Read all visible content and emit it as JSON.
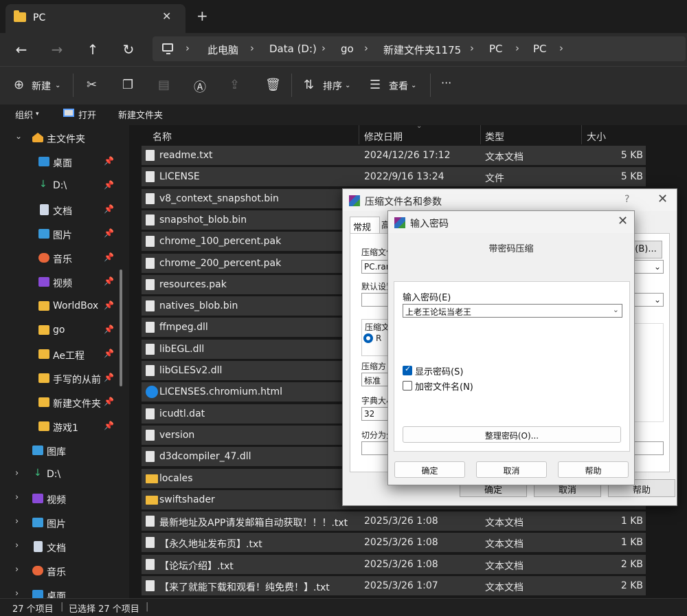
{
  "tab": {
    "title": "PC"
  },
  "nav": {
    "back": "←",
    "forward": "→",
    "up": "↑",
    "refresh": "↻",
    "breadcrumb": [
      "此电脑",
      "Data (D:)",
      "go",
      "新建文件夹1175",
      "PC",
      "PC"
    ]
  },
  "toolbar": {
    "new_label": "新建",
    "sort_label": "排序",
    "view_label": "查看",
    "more_label": "···"
  },
  "subbar": {
    "organize": "组织",
    "open": "打开",
    "new_folder": "新建文件夹"
  },
  "sidebar": {
    "home": "主文件夹",
    "pinned": [
      "桌面",
      "D:\\",
      "文档",
      "图片",
      "音乐",
      "视频",
      "WorldBox",
      "go",
      "Ae工程",
      "手写的从前",
      "新建文件夹",
      "游戏1"
    ],
    "gallery": "图库",
    "tree": [
      "D:\\",
      "视频",
      "图片",
      "文档",
      "音乐",
      "桌面"
    ]
  },
  "columns": {
    "name": "名称",
    "date": "修改日期",
    "type": "类型",
    "size": "大小"
  },
  "files": [
    {
      "name": "readme.txt",
      "date": "2024/12/26 17:12",
      "type": "文本文档",
      "size": "5 KB",
      "icon": "doc"
    },
    {
      "name": "LICENSE",
      "date": "2022/9/16 13:24",
      "type": "文件",
      "size": "5 KB",
      "icon": "file"
    },
    {
      "name": "v8_context_snapshot.bin",
      "date": "",
      "type": "",
      "size": "",
      "icon": "file"
    },
    {
      "name": "snapshot_blob.bin",
      "date": "",
      "type": "",
      "size": "",
      "icon": "file"
    },
    {
      "name": "chrome_100_percent.pak",
      "date": "",
      "type": "",
      "size": "",
      "icon": "file"
    },
    {
      "name": "chrome_200_percent.pak",
      "date": "",
      "type": "",
      "size": "",
      "icon": "file"
    },
    {
      "name": "resources.pak",
      "date": "",
      "type": "",
      "size": "",
      "icon": "file"
    },
    {
      "name": "natives_blob.bin",
      "date": "",
      "type": "",
      "size": "",
      "icon": "file"
    },
    {
      "name": "ffmpeg.dll",
      "date": "",
      "type": "",
      "size": "",
      "icon": "dll"
    },
    {
      "name": "libEGL.dll",
      "date": "",
      "type": "",
      "size": "",
      "icon": "dll"
    },
    {
      "name": "libGLESv2.dll",
      "date": "",
      "type": "",
      "size": "",
      "icon": "dll"
    },
    {
      "name": "LICENSES.chromium.html",
      "date": "",
      "type": "",
      "size": "",
      "icon": "edge"
    },
    {
      "name": "icudtl.dat",
      "date": "",
      "type": "",
      "size": "",
      "icon": "file"
    },
    {
      "name": "version",
      "date": "",
      "type": "",
      "size": "",
      "icon": "file"
    },
    {
      "name": "d3dcompiler_47.dll",
      "date": "",
      "type": "",
      "size": "",
      "icon": "dll"
    },
    {
      "name": "locales",
      "date": "",
      "type": "",
      "size": "",
      "icon": "folder"
    },
    {
      "name": "swiftshader",
      "date": "",
      "type": "",
      "size": "",
      "icon": "folder"
    },
    {
      "name": "最新地址及APP请发邮箱自动获取！！！.txt",
      "date": "2025/3/26 1:08",
      "type": "文本文档",
      "size": "1 KB",
      "icon": "doc"
    },
    {
      "name": "【永久地址发布页】.txt",
      "date": "2025/3/26 1:08",
      "type": "文本文档",
      "size": "1 KB",
      "icon": "doc"
    },
    {
      "name": "【论坛介绍】.txt",
      "date": "2025/3/26 1:08",
      "type": "文本文档",
      "size": "2 KB",
      "icon": "doc"
    },
    {
      "name": "【来了就能下载和观看！纯免费！】.txt",
      "date": "2025/3/26 1:07",
      "type": "文本文档",
      "size": "2 KB",
      "icon": "doc"
    }
  ],
  "status": {
    "count": "27 个项目",
    "selected": "已选择 27 个项目"
  },
  "archive_dialog": {
    "title": "压缩文件名和参数",
    "help": "?",
    "tab_general": "常规",
    "tab_adv": "高",
    "archive_name_label": "压缩文件",
    "browse": "(B)...",
    "archive_name": "PC.rar",
    "profile_label": "默认设置",
    "format_label": "压缩文",
    "format_value": "R",
    "method_label": "压缩方",
    "method_value": "标准",
    "dict_label": "字典大小",
    "dict_value": "32",
    "split_label": "切分为分",
    "ok": "确定",
    "cancel": "取消",
    "help_btn": "帮助"
  },
  "password_dialog": {
    "title": "输入密码",
    "heading": "带密码压缩",
    "password_label": "输入密码(E)",
    "password_value": "上老王论坛当老王",
    "show_password": "显示密码(S)",
    "encrypt_names": "加密文件名(N)",
    "organize": "整理密码(O)...",
    "ok": "确定",
    "cancel": "取消",
    "help": "帮助"
  }
}
